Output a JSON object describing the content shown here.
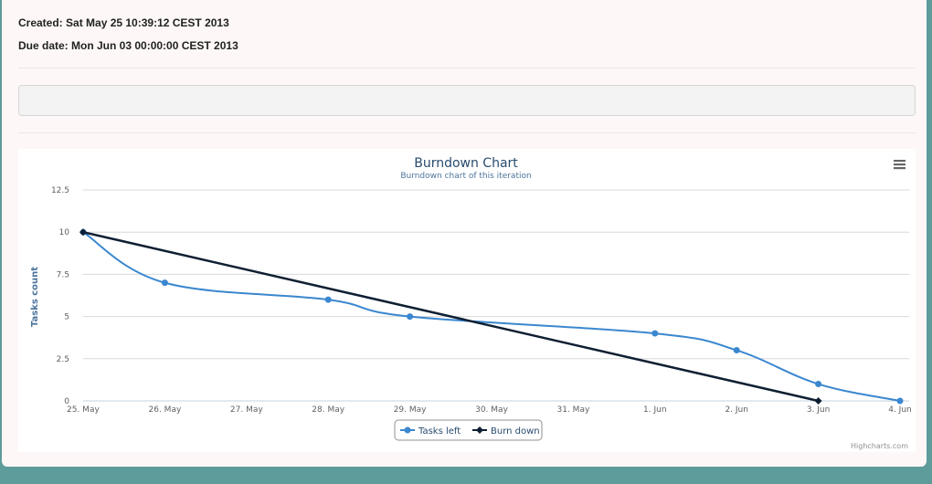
{
  "meta": {
    "created": "Created: Sat May 25 10:39:12 CEST 2013",
    "due_date": "Due date: Mon Jun 03 00:00:00 CEST 2013"
  },
  "colors": {
    "background": "#5e9c9b",
    "tasks_left": "#3a87cf",
    "burn_down": "#0f1f33",
    "title": "#274b6d"
  },
  "chart_menu_icon": "hamburger-menu-icon",
  "chart_data": {
    "type": "line",
    "title": "Burndown Chart",
    "subtitle": "Burndown chart of this iteration",
    "xlabel": "",
    "ylabel": "Tasks count",
    "categories": [
      "25. May",
      "26. May",
      "27. May",
      "28. May",
      "29. May",
      "30. May",
      "31. May",
      "1. Jun",
      "2. Jun",
      "3. Jun",
      "4. Jun"
    ],
    "ylim": [
      0,
      12.5
    ],
    "yticks": [
      "0",
      "2.5",
      "5",
      "7.5",
      "10",
      "12.5"
    ],
    "grid": true,
    "legend_position": "bottom-center",
    "credits": "Highcharts.com",
    "series": [
      {
        "name": "Tasks left",
        "values": [
          10,
          7,
          null,
          6,
          5,
          null,
          null,
          4,
          3,
          1,
          0
        ],
        "color": "#3a87cf",
        "marker": "circle"
      },
      {
        "name": "Burn down",
        "values": [
          10,
          null,
          null,
          null,
          null,
          null,
          null,
          null,
          null,
          0,
          null
        ],
        "color": "#0f1f33",
        "marker": "diamond"
      }
    ]
  }
}
